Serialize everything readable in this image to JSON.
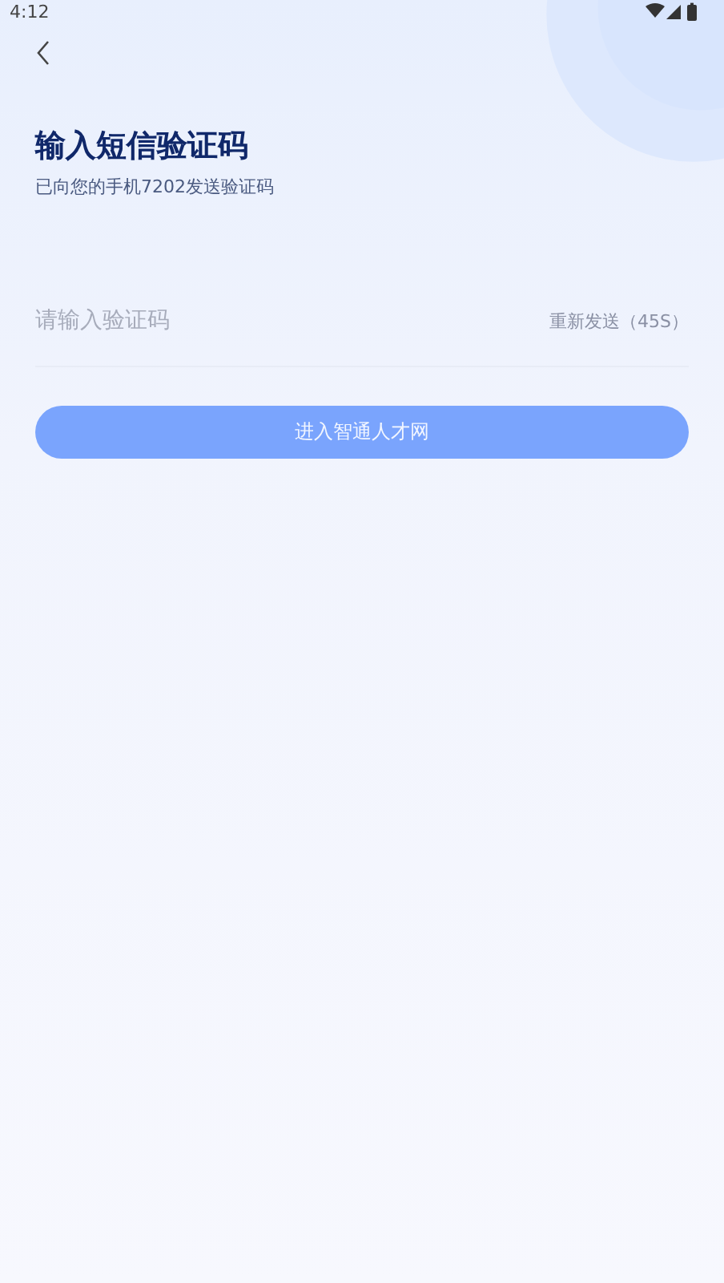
{
  "status_bar": {
    "time": "4:12"
  },
  "title": "输入短信验证码",
  "subtitle": "已向您的手机7202发送验证码",
  "code_field": {
    "placeholder": "请输入验证码"
  },
  "resend": {
    "label": "重新发送（45S）",
    "disabled": true
  },
  "submit": {
    "label": "进入智通人才网",
    "disabled": true
  }
}
